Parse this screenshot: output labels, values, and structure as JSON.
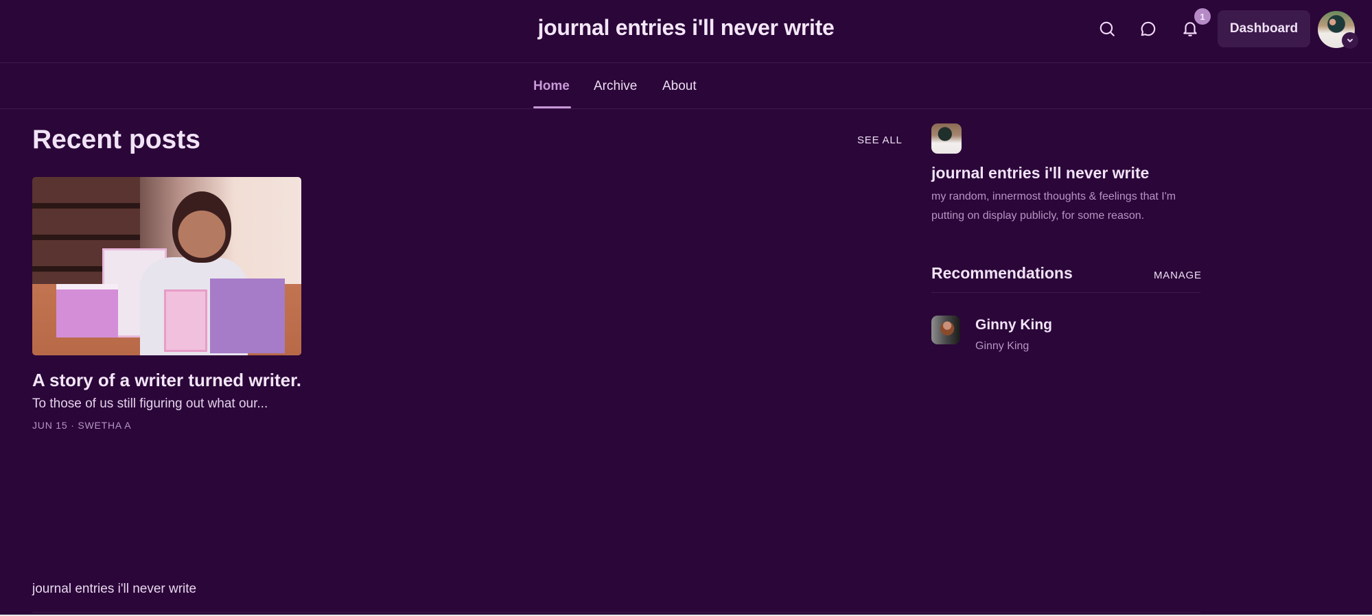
{
  "header": {
    "site_title": "journal entries i'll never write",
    "icons": [
      "search-icon",
      "chat-bubble-icon",
      "bell-icon"
    ],
    "notification_count": "1",
    "dashboard_label": "Dashboard",
    "profile_menu_icon": "chevron-down-icon"
  },
  "nav": {
    "items": [
      {
        "label": "Home",
        "active": true
      },
      {
        "label": "Archive",
        "active": false
      },
      {
        "label": "About",
        "active": false
      }
    ]
  },
  "main": {
    "section_title": "Recent posts",
    "see_all_label": "SEE ALL",
    "posts": [
      {
        "title": "A story of a writer turned writer.",
        "excerpt": "To those of us still figuring out what our...",
        "date": "JUN 15",
        "author": "SWETHA A",
        "meta_separator": "·"
      }
    ]
  },
  "sidebar": {
    "publication_title": "journal entries i'll never write",
    "publication_description": "my random, innermost thoughts & feelings that I'm putting on display publicly, for some reason.",
    "recommendations_title": "Recommendations",
    "manage_label": "MANAGE",
    "recommendations": [
      {
        "name": "Ginny King",
        "subtitle": "Ginny King"
      }
    ]
  },
  "footer": {
    "site_title": "journal entries i'll never write"
  },
  "colors": {
    "background": "#2b0639",
    "accent": "#c89ad8",
    "text": "#f1e3f6",
    "muted_text": "#b596c2",
    "button_bg": "#3d1a4c",
    "badge_bg": "#b58ac6"
  }
}
